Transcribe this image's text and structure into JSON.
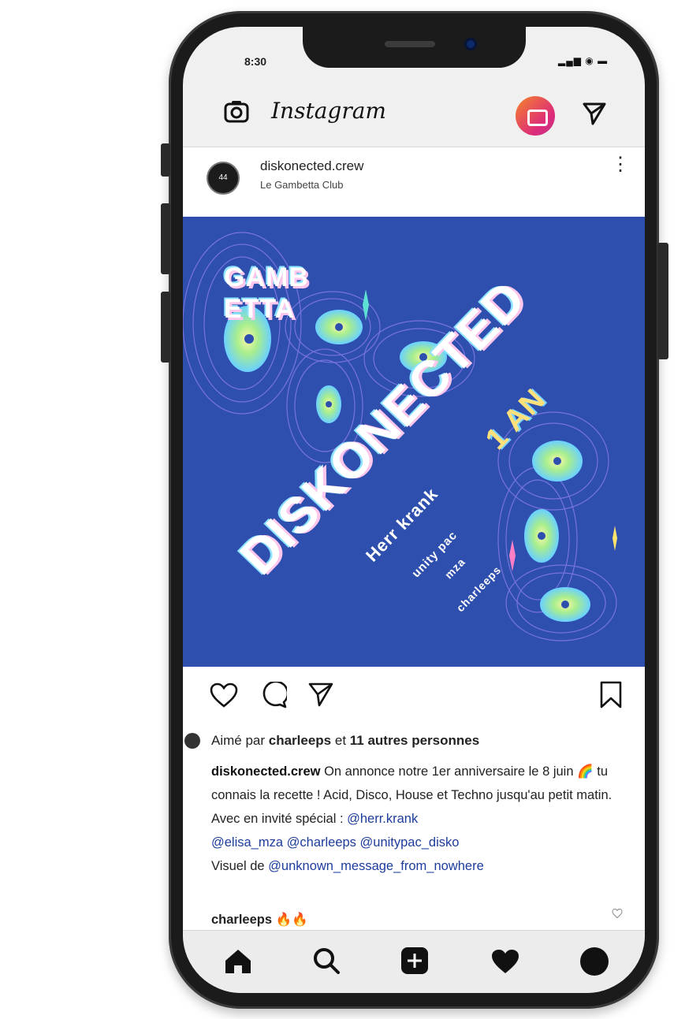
{
  "status": {
    "time": "8:30",
    "icons": "▂▄▆ ◉ ▬"
  },
  "app": {
    "brand": "Instagram"
  },
  "post": {
    "username": "diskonected.crew",
    "location": "Le Gambetta Club",
    "avatar_text": "44"
  },
  "artwork": {
    "title": "DISKONECTED",
    "venue_line1": "GAMB",
    "venue_line2": "ETTA",
    "anniversary": "1 AN",
    "headliner": "Herr krank",
    "support": [
      "unity pac",
      "mza",
      "charleeps"
    ]
  },
  "engagement": {
    "likes_prefix": "Aimé par ",
    "likes_user": "charleeps",
    "likes_middle": " et ",
    "likes_others": "11 autres personnes"
  },
  "caption": {
    "user": "diskonected.crew",
    "text": " On annonce notre 1er anniversaire le 8 juin 🌈 tu connais la recette ! Acid, Disco, House et Techno jusqu'au petit matin. Avec en invité spécial : ",
    "mention1": "@herr.krank",
    "mention2": "@elisa_mza",
    "mention3": "@charleeps",
    "mention4": "@unitypac_disko",
    "credit_prefix": "Visuel de ",
    "credit_mention": "@unknown_message_from_nowhere"
  },
  "comment": {
    "user": "charleeps",
    "text": " 🔥🔥"
  },
  "icons": {
    "camera": "camera-icon",
    "direct": "paper-plane-icon",
    "like": "heart-icon",
    "comment": "comment-bubble-icon",
    "share": "paper-plane-icon",
    "save": "bookmark-icon",
    "home": "home-icon",
    "search": "search-icon",
    "add": "add-post-icon",
    "activity": "heart-filled-icon",
    "profile": "profile-icon"
  }
}
